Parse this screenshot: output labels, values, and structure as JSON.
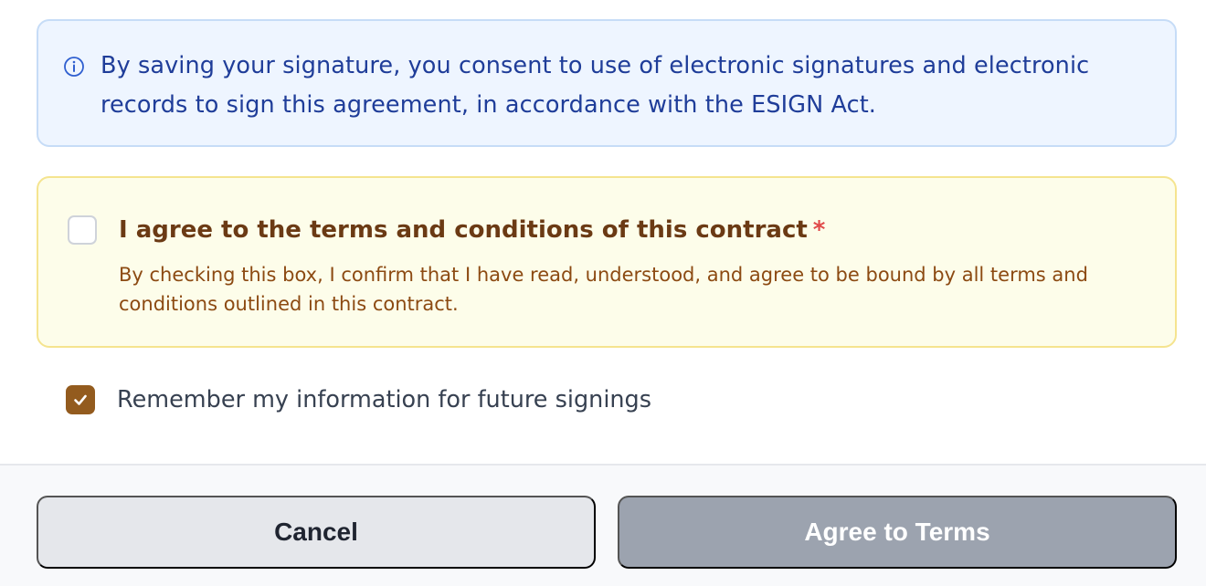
{
  "consent_notice": {
    "icon": "info-icon",
    "text": "By saving your signature, you consent to use of electronic signatures and electronic records to sign this agreement, in accordance with the ESIGN Act."
  },
  "terms": {
    "checked": false,
    "title": "I agree to the terms and conditions of this contract",
    "required_marker": "*",
    "description": "By checking this box, I confirm that I have read, understood, and agree to be bound by all terms and conditions outlined in this contract."
  },
  "remember": {
    "checked": true,
    "label": "Remember my information for future signings"
  },
  "footer": {
    "cancel_label": "Cancel",
    "agree_label": "Agree to Terms"
  },
  "colors": {
    "info_bg": "#eef5ff",
    "info_text": "#1f3d99",
    "terms_bg": "#fdfdea",
    "terms_border": "#f5e48f",
    "terms_title": "#6b3a14",
    "required": "#e04a4a",
    "checkbox_checked": "#935b1e",
    "agree_disabled": "#9ca3af"
  }
}
